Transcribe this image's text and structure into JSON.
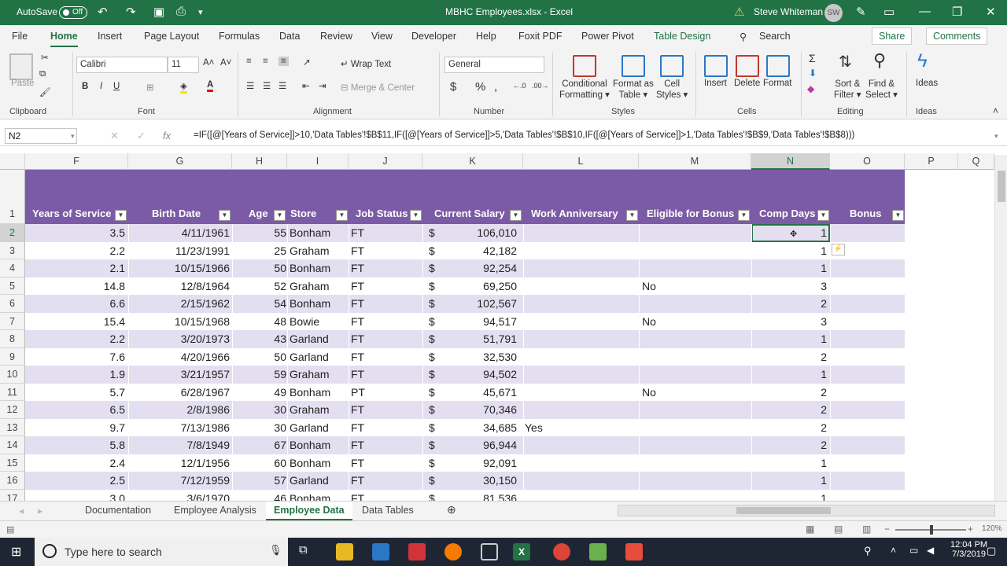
{
  "title_bar": {
    "autosave": "AutoSave",
    "autosave_state": "Off",
    "filename": "MBHC Employees.xlsx  -  Excel",
    "user": "Steve Whiteman",
    "user_initials": "SW"
  },
  "menu": {
    "items": [
      "File",
      "Home",
      "Insert",
      "Page Layout",
      "Formulas",
      "Data",
      "Review",
      "View",
      "Developer",
      "Help",
      "Foxit PDF",
      "Power Pivot",
      "Table Design"
    ],
    "search": "Search",
    "share": "Share",
    "comments": "Comments"
  },
  "ribbon": {
    "clipboard": {
      "paste": "Paste",
      "label": "Clipboard"
    },
    "font": {
      "name": "Calibri",
      "size": "11",
      "label": "Font",
      "bold": "B",
      "italic": "I",
      "underline": "U"
    },
    "alignment": {
      "wrap": "Wrap Text",
      "merge": "Merge & Center",
      "label": "Alignment"
    },
    "number": {
      "format": "General",
      "label": "Number",
      "currency": "$",
      "percent": "%"
    },
    "styles": {
      "cond": "Conditional",
      "cond2": "Formatting",
      "fmt_table": "Format as",
      "fmt_table2": "Table",
      "cell_styles": "Cell",
      "cell_styles2": "Styles",
      "label": "Styles"
    },
    "cells": {
      "insert": "Insert",
      "delete": "Delete",
      "format": "Format",
      "label": "Cells"
    },
    "editing": {
      "sort": "Sort &",
      "sort2": "Filter",
      "find": "Find &",
      "find2": "Select",
      "label": "Editing"
    },
    "ideas": {
      "ideas": "Ideas",
      "label": "Ideas"
    }
  },
  "formula_bar": {
    "name_box": "N2",
    "formula": "=IF([@[Years of Service]]>10,'Data Tables'!$B$11,IF([@[Years of Service]]>5,'Data Tables'!$B$10,IF([@[Years of Service]]>1,'Data Tables'!$B$9,'Data Tables'!$B$8)))"
  },
  "columns": [
    "F",
    "G",
    "H",
    "I",
    "J",
    "K",
    "L",
    "M",
    "N",
    "O",
    "P",
    "Q"
  ],
  "headers": [
    "Years of Service",
    "Birth Date",
    "Age",
    "Store",
    "Job Status",
    "Current Salary",
    "Work Anniversary",
    "Eligible for Bonus",
    "Comp Days",
    "Bonus"
  ],
  "rows": [
    {
      "n": "1"
    },
    {
      "n": "2",
      "ys": "3.5",
      "bd": "4/11/1961",
      "age": "55",
      "store": "Bonham",
      "js": "FT",
      "sal": "106,010",
      "wa": "",
      "eb": "",
      "cd": "1"
    },
    {
      "n": "3",
      "ys": "2.2",
      "bd": "11/23/1991",
      "age": "25",
      "store": "Graham",
      "js": "FT",
      "sal": "42,182",
      "wa": "",
      "eb": "",
      "cd": "1"
    },
    {
      "n": "4",
      "ys": "2.1",
      "bd": "10/15/1966",
      "age": "50",
      "store": "Bonham",
      "js": "FT",
      "sal": "92,254",
      "wa": "",
      "eb": "",
      "cd": "1"
    },
    {
      "n": "5",
      "ys": "14.8",
      "bd": "12/8/1964",
      "age": "52",
      "store": "Graham",
      "js": "FT",
      "sal": "69,250",
      "wa": "",
      "eb": "No",
      "cd": "3"
    },
    {
      "n": "6",
      "ys": "6.6",
      "bd": "2/15/1962",
      "age": "54",
      "store": "Bonham",
      "js": "FT",
      "sal": "102,567",
      "wa": "",
      "eb": "",
      "cd": "2"
    },
    {
      "n": "7",
      "ys": "15.4",
      "bd": "10/15/1968",
      "age": "48",
      "store": "Bowie",
      "js": "FT",
      "sal": "94,517",
      "wa": "",
      "eb": "No",
      "cd": "3"
    },
    {
      "n": "8",
      "ys": "2.2",
      "bd": "3/20/1973",
      "age": "43",
      "store": "Garland",
      "js": "FT",
      "sal": "51,791",
      "wa": "",
      "eb": "",
      "cd": "1"
    },
    {
      "n": "9",
      "ys": "7.6",
      "bd": "4/20/1966",
      "age": "50",
      "store": "Garland",
      "js": "FT",
      "sal": "32,530",
      "wa": "",
      "eb": "",
      "cd": "2"
    },
    {
      "n": "10",
      "ys": "1.9",
      "bd": "3/21/1957",
      "age": "59",
      "store": "Graham",
      "js": "FT",
      "sal": "94,502",
      "wa": "",
      "eb": "",
      "cd": "1"
    },
    {
      "n": "11",
      "ys": "5.7",
      "bd": "6/28/1967",
      "age": "49",
      "store": "Bonham",
      "js": "PT",
      "sal": "45,671",
      "wa": "",
      "eb": "No",
      "cd": "2"
    },
    {
      "n": "12",
      "ys": "6.5",
      "bd": "2/8/1986",
      "age": "30",
      "store": "Graham",
      "js": "FT",
      "sal": "70,346",
      "wa": "",
      "eb": "",
      "cd": "2"
    },
    {
      "n": "13",
      "ys": "9.7",
      "bd": "7/13/1986",
      "age": "30",
      "store": "Garland",
      "js": "FT",
      "sal": "34,685",
      "wa": "Yes",
      "eb": "",
      "cd": "2"
    },
    {
      "n": "14",
      "ys": "5.8",
      "bd": "7/8/1949",
      "age": "67",
      "store": "Bonham",
      "js": "FT",
      "sal": "96,944",
      "wa": "",
      "eb": "",
      "cd": "2"
    },
    {
      "n": "15",
      "ys": "2.4",
      "bd": "12/1/1956",
      "age": "60",
      "store": "Bonham",
      "js": "FT",
      "sal": "92,091",
      "wa": "",
      "eb": "",
      "cd": "1"
    },
    {
      "n": "16",
      "ys": "2.5",
      "bd": "7/12/1959",
      "age": "57",
      "store": "Garland",
      "js": "FT",
      "sal": "30,150",
      "wa": "",
      "eb": "",
      "cd": "1"
    },
    {
      "n": "17",
      "ys": "3.0",
      "bd": "3/6/1970",
      "age": "46",
      "store": "Bonham",
      "js": "FT",
      "sal": "81,536",
      "wa": "",
      "eb": "",
      "cd": "1"
    }
  ],
  "currency_symbol": "$",
  "sheet_tabs": [
    "Documentation",
    "Employee Analysis",
    "Employee Data",
    "Data Tables"
  ],
  "status": {
    "zoom": "120%"
  },
  "taskbar": {
    "search": "Type here to search",
    "time": "12:04 PM",
    "date": "7/3/2019"
  },
  "colors": {
    "excel_green": "#217346",
    "table_header": "#7b5ba6",
    "band": "#e4dff0"
  }
}
